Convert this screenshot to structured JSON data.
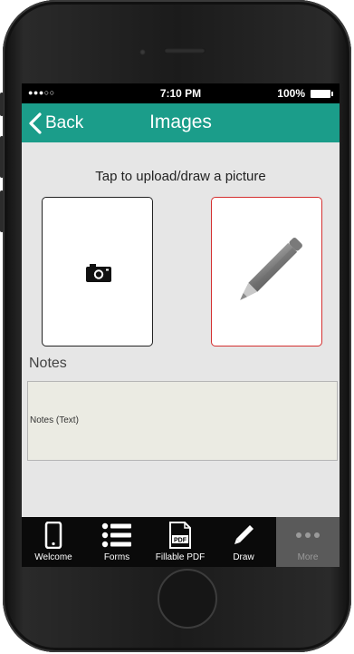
{
  "status_bar": {
    "signal": "●●●○○",
    "time": "7:10 PM",
    "battery": "100%"
  },
  "nav": {
    "back_label": "Back",
    "title": "Images"
  },
  "instruction": "Tap to upload/draw a picture",
  "tiles": {
    "camera_icon": "camera-icon",
    "draw_icon": "pencil-icon"
  },
  "notes": {
    "label": "Notes",
    "value": "Notes (Text)"
  },
  "tabs": [
    {
      "label": "Welcome",
      "icon": "phone-icon"
    },
    {
      "label": "Forms",
      "icon": "list-icon"
    },
    {
      "label": "Fillable PDF",
      "icon": "pdf-icon"
    },
    {
      "label": "Draw",
      "icon": "pencil-icon"
    },
    {
      "label": "More",
      "icon": "more-icon"
    }
  ],
  "colors": {
    "accent": "#1b9d8a",
    "draw_border": "#d43030"
  }
}
